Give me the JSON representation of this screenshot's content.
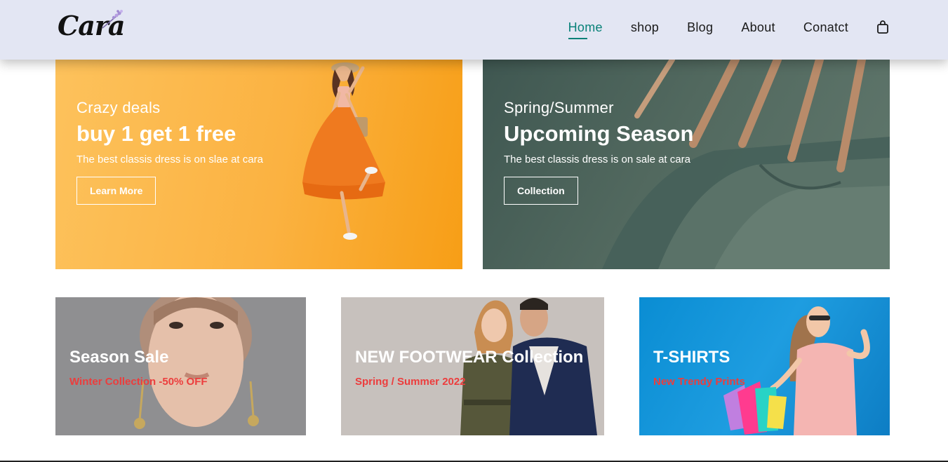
{
  "header": {
    "logo_text": "Cara",
    "nav": [
      {
        "label": "Home",
        "active": true
      },
      {
        "label": "shop",
        "active": false
      },
      {
        "label": "Blog",
        "active": false
      },
      {
        "label": "About",
        "active": false
      },
      {
        "label": "Conatct",
        "active": false
      }
    ],
    "cart_icon": "shopping-bag-icon"
  },
  "banners_big": [
    {
      "kicker": "Crazy deals",
      "title": "buy 1 get 1 free",
      "subtitle": "The best classis dress is on slae at cara",
      "button": "Learn More"
    },
    {
      "kicker": "Spring/Summer",
      "title": "Upcoming Season",
      "subtitle": "The best classis dress is on sale at cara",
      "button": "Collection"
    }
  ],
  "banners_small": [
    {
      "title": "Season Sale",
      "subtitle": "Winter Collection -50% OFF"
    },
    {
      "title": "NEW FOOTWEAR Collection",
      "subtitle": "Spring / Summer 2022"
    },
    {
      "title": "T-SHIRTS",
      "subtitle": "New Trendy Prints"
    }
  ],
  "colors": {
    "accent": "#088178",
    "header_bg": "#e3e6f3",
    "small_banner_subtitle": "#ec3d3d"
  }
}
